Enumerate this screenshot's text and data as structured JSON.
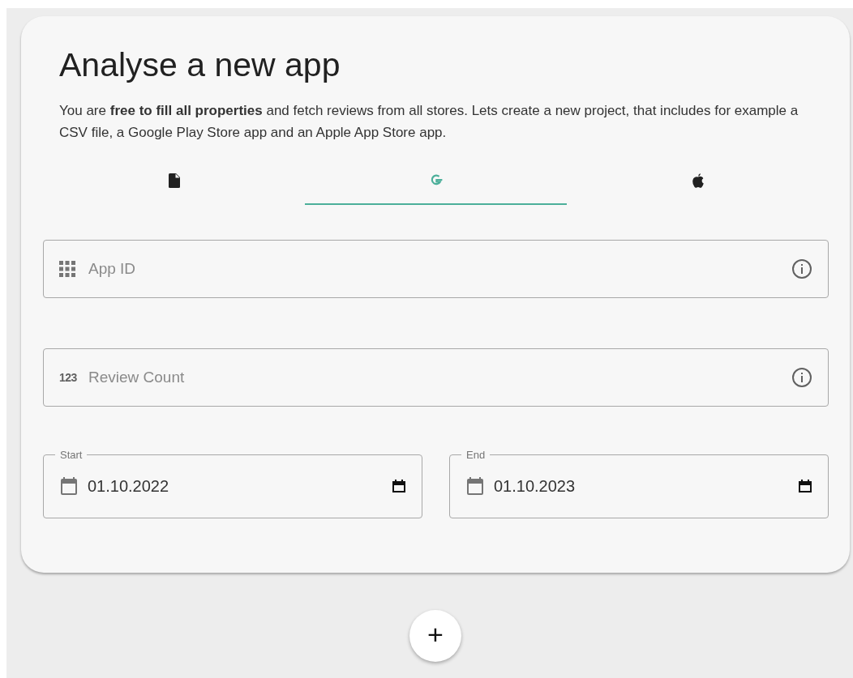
{
  "card": {
    "title": "Analyse a new app",
    "description": "You are **free to fill all properties** and fetch reviews from all stores. Lets create a new project, that includes for example a CSV file, a Google Play Store app and an Apple App Store app."
  },
  "tabs": [
    {
      "kind": "file",
      "selected": false
    },
    {
      "kind": "google",
      "selected": true
    },
    {
      "kind": "apple",
      "selected": false
    }
  ],
  "fields": [
    {
      "kind": "grid",
      "placeholder": "App ID"
    },
    {
      "kind": "digits",
      "icon_text": "123",
      "placeholder": "Review Count"
    }
  ],
  "dates": [
    {
      "label": "Start",
      "value": "01.10.2022"
    },
    {
      "label": "End",
      "value": "01.10.2023"
    }
  ],
  "add_button": {
    "label": "+"
  }
}
